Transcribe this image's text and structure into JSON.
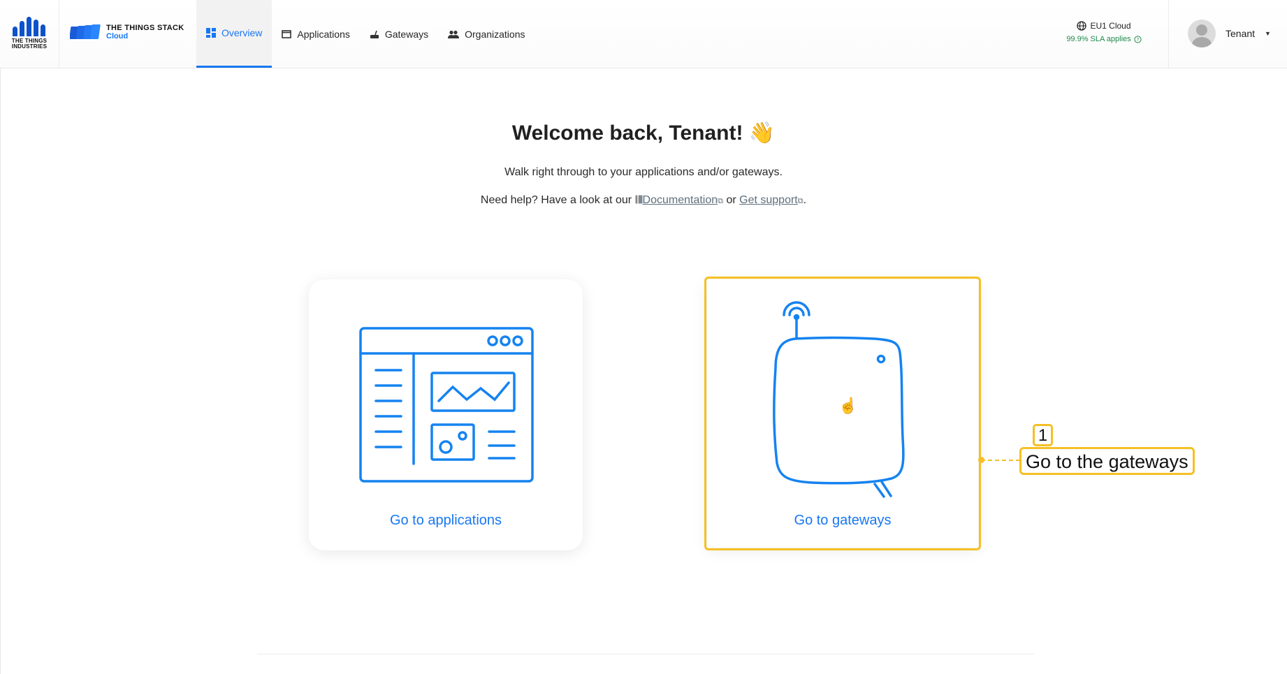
{
  "header": {
    "org_logo_text": "THE THINGS INDUSTRIES",
    "product_name": "THE THINGS STACK",
    "product_sub": "Cloud",
    "nav": [
      {
        "label": "Overview",
        "icon": "dashboard-icon"
      },
      {
        "label": "Applications",
        "icon": "window-icon"
      },
      {
        "label": "Gateways",
        "icon": "router-icon"
      },
      {
        "label": "Organizations",
        "icon": "people-icon"
      }
    ],
    "cluster": {
      "name": "EU1 Cloud",
      "sla": "99.9% SLA applies"
    },
    "user": {
      "name": "Tenant"
    }
  },
  "main": {
    "welcome": "Welcome back, Tenant! 👋",
    "subtitle": "Walk right through to your applications and/or gateways.",
    "help_prefix": "Need help? Have a look at our",
    "docs_link": "Documentation",
    "help_or": "or",
    "support_link": "Get support",
    "help_suffix": ".",
    "cards": [
      {
        "label": "Go to applications"
      },
      {
        "label": "Go to gateways"
      }
    ]
  },
  "annotation": {
    "number": "1",
    "text": "Go to the gateways"
  },
  "colors": {
    "accent": "#1877f2",
    "highlight": "#f5c024",
    "sla": "#1f8a4c"
  }
}
